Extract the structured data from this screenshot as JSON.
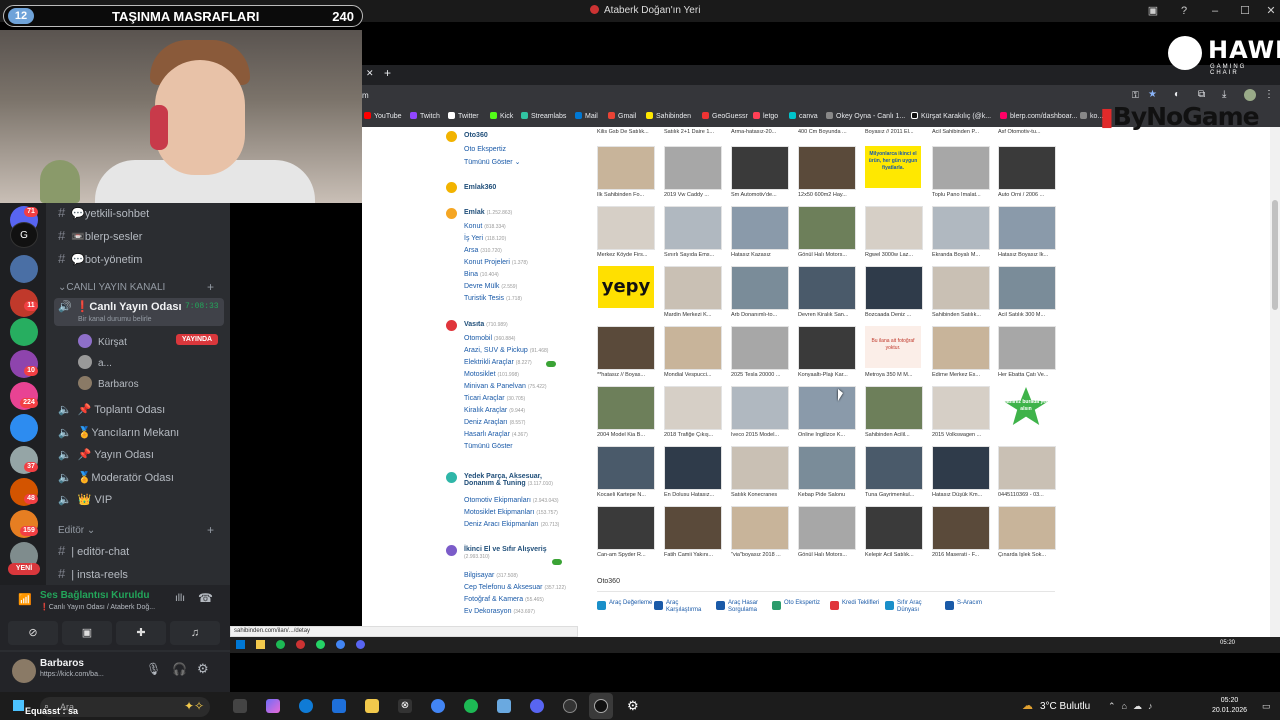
{
  "window": {
    "title": "Ataberk Doğan'ın Yeri"
  },
  "overlay": {
    "moving_count": "12",
    "moving_title": "TAŞINMA MASRAFLARI",
    "moving_value": "240"
  },
  "logos": {
    "hawk": "HAWK",
    "hawk_sub": "GAMING CHAIR",
    "bynogame": "ByNoGame"
  },
  "discord": {
    "channels_top": [
      {
        "name": "💬yetkili-sohbet"
      },
      {
        "name": "📼blerp-sesler"
      },
      {
        "name": "💬bot-yönetim"
      }
    ],
    "category_live": "CANLI YAYIN KANALI",
    "live_channel": "❗Canlı Yayın Odası",
    "live_timer": "7:08:33",
    "live_status": "Bir kanal durumu belirle",
    "members": [
      {
        "name": "Kürşat",
        "badge": "YAYINDA"
      },
      {
        "name": "a..."
      },
      {
        "name": "Barbaros"
      }
    ],
    "voice_channels": [
      "📌 Toplantı Odası",
      "🏅Yancıların Mekanı",
      "📌 Yayın Odası",
      "🏅Moderatör Odası",
      "👑 VIP"
    ],
    "category_editor": "Editör",
    "editor_channels": [
      "| editör-chat",
      "| insta-reels"
    ],
    "voice_connected": "Ses Bağlantısı Kuruldu",
    "voice_location": "❗Canlı Yayın Odası / Ataberk Doğ...",
    "user_name": "Barbaros",
    "user_status": "https://kick.com/ba...",
    "new_badge": "YENİ",
    "guild_badges": [
      "71",
      "11",
      "10",
      "224",
      "37",
      "48",
      "159"
    ]
  },
  "browser": {
    "address": "m",
    "bookmarks": [
      "YouTube",
      "Twitch",
      "Twitter",
      "Kick",
      "Streamlabs",
      "Mail",
      "Gmail",
      "Sahibinden",
      "GeoGuessr",
      "letgo",
      "canva",
      "Okey Oyna - Canlı 1...",
      "Kürşat Karakılıç (@k...",
      "blerp.com/dashboar...",
      "ko..."
    ],
    "status_url": "sahibinden.com/ilan/.../detay"
  },
  "sidebar": {
    "oto360": {
      "title": "Oto360",
      "items": [
        "Oto Ekspertiz",
        "Tümünü Göster"
      ]
    },
    "emlak360": {
      "title": "Emlak360"
    },
    "emlak": {
      "title": "Emlak",
      "count": "(1.252.863)",
      "items": [
        {
          "label": "Konut",
          "n": "(818.334)"
        },
        {
          "label": "İş Yeri",
          "n": "(118.120)"
        },
        {
          "label": "Arsa",
          "n": "(310.720)"
        },
        {
          "label": "Konut Projeleri",
          "n": "(1.378)"
        },
        {
          "label": "Bina",
          "n": "(10.404)"
        },
        {
          "label": "Devre Mülk",
          "n": "(2.559)"
        },
        {
          "label": "Turistik Tesis",
          "n": "(1.718)"
        }
      ]
    },
    "vasita": {
      "title": "Vasıta",
      "count": "(710.989)",
      "items": [
        {
          "label": "Otomobil",
          "n": "(360.884)"
        },
        {
          "label": "Arazi, SUV & Pickup",
          "n": "(91.468)"
        },
        {
          "label": "Elektrikli Araçlar",
          "n": "(8.227)"
        },
        {
          "label": "Motosiklet",
          "n": "(101.998)"
        },
        {
          "label": "Minivan & Panelvan",
          "n": "(75.422)"
        },
        {
          "label": "Ticari Araçlar",
          "n": "(30.705)"
        },
        {
          "label": "Kiralık Araçlar",
          "n": "(9.944)"
        },
        {
          "label": "Deniz Araçları",
          "n": "(8.557)"
        },
        {
          "label": "Hasarlı Araçlar",
          "n": "(4.367)"
        },
        {
          "label": "Tümünü Göster",
          "n": ""
        }
      ]
    },
    "yedek": {
      "title": "Yedek Parça, Aksesuar, Donanım & Tuning",
      "count": "(3.117.010)",
      "items": [
        {
          "label": "Otomotiv Ekipmanları",
          "n": "(2.943.043)"
        },
        {
          "label": "Motosiklet Ekipmanları",
          "n": "(153.757)"
        },
        {
          "label": "Deniz Aracı Ekipmanları",
          "n": "(20.713)"
        }
      ]
    },
    "ikinciel": {
      "title": "İkinci El ve Sıfır Alışveriş",
      "count": "(2.993.310)",
      "items": [
        {
          "label": "Bilgisayar",
          "n": "(317.508)"
        },
        {
          "label": "Cep Telefonu & Aksesuar",
          "n": "(357.122)"
        },
        {
          "label": "Fotoğraf & Kamera",
          "n": "(55.465)"
        },
        {
          "label": "Ev Dekorasyon",
          "n": "(343.697)"
        }
      ]
    }
  },
  "listings": {
    "top_captions": [
      "Kilis Gsb De Satılık...",
      "Satılık 2+1 Daire 1...",
      "Arma-hatasız-20...",
      "400 Cm Boyunda ...",
      "Boyasız // 2011 El...",
      "Acil Sahibinden P...",
      "Asf Otomotiv-tu..."
    ],
    "rows": [
      [
        "İlk Sahibinden Fo...",
        "2019 Vw Caddy ...",
        "Sm Automotiv'de...",
        "12x50 600m2 Hay...",
        "",
        "Toplu Pano İmalat...",
        "Auto Orni / 2006 ..."
      ],
      [
        "Merkez Köyde Firs...",
        "Sınırlı Sayıda Ems...",
        "Hatasız Kazasız",
        "Gönül Halı Motors...",
        "Rgwel 3000w Laz...",
        "Ekranda Boyalı M...",
        "Hatasız Boyasız İk..."
      ],
      [
        "",
        "Mardin Merkezi K...",
        "Arb Donanımlı-to...",
        "Devren Kiralık San...",
        "Bozcaada Deniz ...",
        "Sahibinden Satılık...",
        "Acil Satılık 300 M..."
      ],
      [
        "**hatasız // Boyas...",
        "Mondial Vespucci...",
        "2025 Tesla 20000 ...",
        "Konyaaltı-Plajı Kar...",
        "Metroya 350 M M...",
        "Edirne Merkez Es...",
        "Her Ebatta Çatı Ve..."
      ],
      [
        "2004 Model Kia B...",
        "2018 Trafiğe Çıkış...",
        "Iveco 2015 Model...",
        "Online İngilizce K...",
        "Sahibinden Acilil...",
        "2015 Volkswagen ...",
        ""
      ],
      [
        "Kocaeli Kartepe N...",
        "En Dolusu Hatasız...",
        "Satılık Konecranes",
        "Kebap Pide Salonu",
        "Tuna Gayrimenkul...",
        "Hatasız Düşük Km...",
        "0445110369 - 03..."
      ],
      [
        "Can-am Spyder R...",
        "Fatih Camii Yakını...",
        "\"via\"boyasız 2018 ...",
        "Gönül Halı Motors...",
        "Kelepir Acil Satılık...",
        "2016 Maserati - F...",
        "Çınarda İşlek Sok..."
      ]
    ],
    "promo_1": "Milyonlarca ikinci el ürün, her gün uygun fiyatlarla.",
    "promo_yepy": "yepy",
    "promo_noimage": "Bu ilana ait fotoğraf yoktur.",
    "promo_star": "İlanınız burada yer alsın",
    "oto360_title": "Oto360",
    "oto360_tools": [
      "Araç Değerleme",
      "Araç Karşılaştırma",
      "Araç Hasar Sorgulama",
      "Oto Ekspertiz",
      "Kredi Teklifleri",
      "Sıfır Araç Dünyası",
      "S-Aracım"
    ]
  },
  "taskbar": {
    "search": "Ara",
    "weather": "3°C  Bulutlu",
    "time": "05:20",
    "date": "20.01.2026",
    "browser_time": "05:20",
    "equasst": "Equasst : sa"
  },
  "colors": {
    "sahibinden_blue": "#1a5aa8",
    "discord_bg": "#2b2d31",
    "live_red": "#da373c"
  }
}
